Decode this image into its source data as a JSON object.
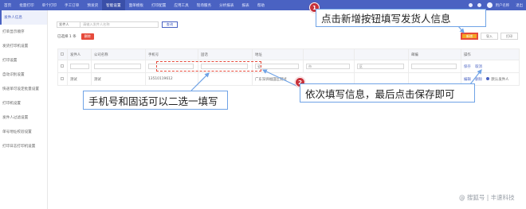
{
  "topnav": {
    "items": [
      "首页",
      "批量打印",
      "单个打印",
      "手工订单",
      "预发货",
      "智能设置",
      "面单模板",
      "打印配置",
      "应用工具",
      "现场服务",
      "分析报表",
      "报表",
      "帮助"
    ],
    "active_index": 5,
    "user_text": "用户名称",
    "exit_text": "退出"
  },
  "sidebar": {
    "items": [
      "发件人信息",
      "打单显示顺序",
      "发货打印机设置",
      "打印设置",
      "自动识别设置",
      "快递单可设定批量设置",
      "打印机设置",
      "发件人过滤设置",
      "单号地址校验设置",
      "打印日志打印机设置"
    ],
    "active_index": 0
  },
  "search": {
    "select_value": "发件人",
    "placeholder": "请输入发件人名称",
    "button_label": "查询"
  },
  "selection": {
    "count_text": "已选择 1 条",
    "delete_label": "删除"
  },
  "actions": {
    "add_label": "新增",
    "import_label": "导入",
    "export_label": "打印"
  },
  "table": {
    "headers": [
      "",
      "发件人",
      "公司名称",
      "手机号",
      "固话",
      "地址",
      "",
      "",
      "邮编",
      "操作"
    ],
    "edit_row": {
      "province": "省",
      "city": "市",
      "district": "区",
      "save_label": "保存",
      "cancel_label": "取消"
    },
    "data_row": {
      "name": "测试",
      "company": "测试",
      "phone": "13510119612",
      "address": "广东深圳福田区测试",
      "edit_label": "编辑",
      "delete_label": "删除",
      "default_label": "默认发件人"
    }
  },
  "annotations": {
    "step1_number": "1",
    "step1_text": "点击新增按钮填写发货人信息",
    "step2_number": "2",
    "step2_text": "依次填写信息，最后点击保存即可",
    "phone_note": "手机号和固话可以二选一填写"
  },
  "watermark": "@ 搜狐号 | 丰速科技",
  "colors": {
    "nav": "#4a62c2",
    "accent_red": "#c8313a",
    "callout_border": "#6fa3e6",
    "add_button": "#f5a623"
  }
}
